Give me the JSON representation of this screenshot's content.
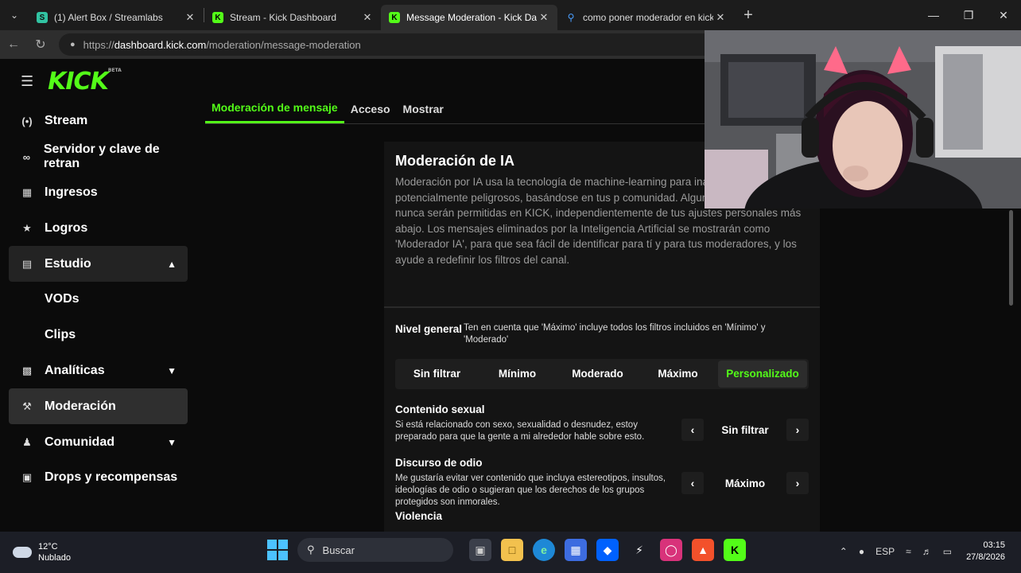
{
  "browser": {
    "tabs": [
      {
        "title": "(1) Alert Box / Streamlabs",
        "favicon": "streamlabs-icon",
        "active": false
      },
      {
        "title": "Stream - Kick Dashboard",
        "favicon": "kick-icon",
        "active": false
      },
      {
        "title": "Message Moderation - Kick Dashb",
        "favicon": "kick-icon",
        "active": true
      },
      {
        "title": "como poner moderador en kick - ",
        "favicon": "search-icon",
        "active": false
      }
    ],
    "url_scheme": "https://",
    "url_host": "dashboard.kick.com",
    "url_path": "/moderation/message-moderation"
  },
  "sidebar": {
    "logo": "KICK",
    "logo_badge": "BETA",
    "items": [
      {
        "label": "Stream",
        "icon": "broadcast-icon"
      },
      {
        "label": "Servidor y clave de retran",
        "icon": "link-icon"
      },
      {
        "label": "Ingresos",
        "icon": "chart-icon"
      },
      {
        "label": "Logros",
        "icon": "trophy-icon"
      },
      {
        "label": "Estudio",
        "icon": "studio-icon"
      },
      {
        "label": "VODs"
      },
      {
        "label": "Clips"
      },
      {
        "label": "Analíticas",
        "icon": "analytics-icon"
      },
      {
        "label": "Moderación",
        "icon": "wrench-icon"
      },
      {
        "label": "Comunidad",
        "icon": "community-icon"
      },
      {
        "label": "Drops y recompensas",
        "icon": "gift-icon"
      }
    ]
  },
  "subtabs": [
    "Moderación de mensaje",
    "Acceso",
    "Mostrar"
  ],
  "card": {
    "title": "Moderación de IA",
    "description": "Moderación por IA usa la tecnología de machine-learning para inapropiados o potencialmente peligrosos, basándose en tus p comunidad. Algunas palabras o frases nunca serán permitidas en KICK, independientemente de tus ajustes personales más abajo. Los mensajes eliminados por la Inteligencia Artificial se mostrarán como 'Moderador IA', para que sea fácil de identificar para tí y para tus moderadores, y los ayude a redefinir los filtros del canal.",
    "nivel_label": "Nivel general",
    "nivel_note": "Ten en cuenta que 'Máximo' incluye todos los filtros incluidos en 'Mínimo' y 'Moderado'",
    "levels": [
      "Sin filtrar",
      "Mínimo",
      "Moderado",
      "Máximo",
      "Personalizado"
    ],
    "selected_level": "Personalizado",
    "categories": [
      {
        "title": "Contenido sexual",
        "desc": "Si está relacionado con sexo, sexualidad o desnudez, estoy preparado para que la gente a mi alrededor hable sobre esto.",
        "value": "Sin filtrar"
      },
      {
        "title": "Discurso de odio",
        "desc": "Me gustaría evitar ver contenido que incluya estereotipos, insultos, ideologías de odio o sugieran que los derechos de los grupos protegidos son inmorales.",
        "value": "Máximo"
      },
      {
        "title": "Violencia",
        "desc": "",
        "value": ""
      }
    ]
  },
  "taskbar": {
    "weather_temp": "12°C",
    "weather_desc": "Nublado",
    "search_placeholder": "Buscar",
    "language": "ESP",
    "time": "03:15",
    "date": "27/8/2026"
  },
  "colors": {
    "kick_green": "#53fc18",
    "bg": "#0b0b0b",
    "card": "#141414"
  }
}
